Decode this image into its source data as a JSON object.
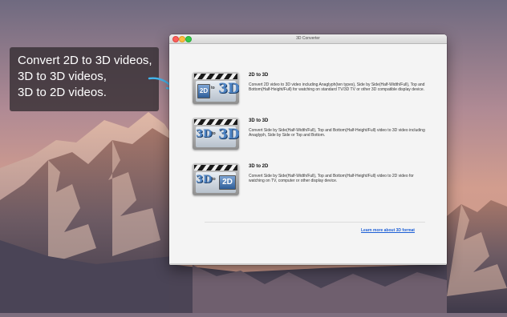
{
  "callout": {
    "lines": [
      "Convert 2D to 3D videos,",
      "3D to 3D videos,",
      "3D to 2D videos."
    ]
  },
  "window": {
    "title": "3D Converter",
    "options": [
      {
        "title": "2D to 3D",
        "description": "Convert 2D video to 3D video including Anaglyph(ten types), Side by Side(Half-Width/Full), Top and Bottom(Half-Height/Full) for watching on standard TV/3D TV or other 3D compatible display device.",
        "icon": {
          "left": "2D",
          "to": "to",
          "right": "3D"
        }
      },
      {
        "title": "3D to 3D",
        "description": "Convert Side by Side(Half-Width/Full), Top and Bottom(Half-Height/Full) video to 3D video including Anaglyph, Side by Side or Top and Bottom.",
        "icon": {
          "left": "3D",
          "to": "to",
          "right": "3D"
        }
      },
      {
        "title": "3D to 2D",
        "description": "Convert Side by Side(Half-Width/Full), Top and Bottom(Half-Height/Full) video to 2D video for watching on TV, computer or other display device.",
        "icon": {
          "left": "3D",
          "to": "to",
          "right": "2D"
        }
      }
    ],
    "learn_more": "Learn more about 3D format"
  },
  "colors": {
    "callout_bg": "#3a3236",
    "link": "#1d5fd6",
    "icon_blue": "#4e84c4"
  }
}
